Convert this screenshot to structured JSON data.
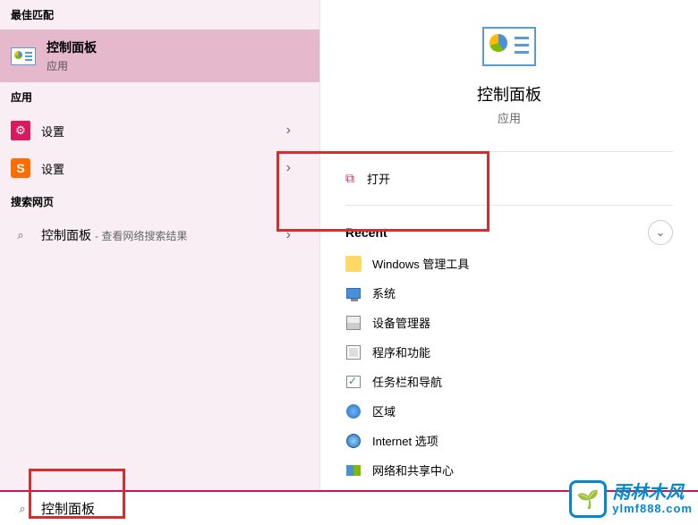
{
  "left": {
    "best_match_header": "最佳匹配",
    "best_match": {
      "title": "控制面板",
      "subtitle": "应用"
    },
    "apps_header": "应用",
    "apps": [
      {
        "label": "设置",
        "icon": "gear-pink"
      },
      {
        "label": "设置",
        "icon": "gear-orange"
      }
    ],
    "web_header": "搜索网页",
    "web": {
      "main": "控制面板",
      "sub": "- 查看网络搜索结果"
    }
  },
  "preview": {
    "title": "控制面板",
    "subtitle": "应用",
    "open_label": "打开",
    "recent_header": "Recent",
    "recent": [
      {
        "label": "Windows 管理工具",
        "icon": "folder"
      },
      {
        "label": "系统",
        "icon": "monitor"
      },
      {
        "label": "设备管理器",
        "icon": "device"
      },
      {
        "label": "程序和功能",
        "icon": "programs"
      },
      {
        "label": "任务栏和导航",
        "icon": "taskbar"
      },
      {
        "label": "区域",
        "icon": "region"
      },
      {
        "label": "Internet 选项",
        "icon": "internet"
      },
      {
        "label": "网络和共享中心",
        "icon": "network"
      }
    ]
  },
  "search": {
    "value": "控制面板"
  },
  "watermark": {
    "brand": "雨林木风",
    "url": "ylmf888.com"
  },
  "glyphs": {
    "chevron_right": "›",
    "chevron_down": "⌄",
    "gear": "⚙",
    "s_letter": "S",
    "search": "⌕",
    "open": "⧉",
    "sprout": "🌱"
  }
}
